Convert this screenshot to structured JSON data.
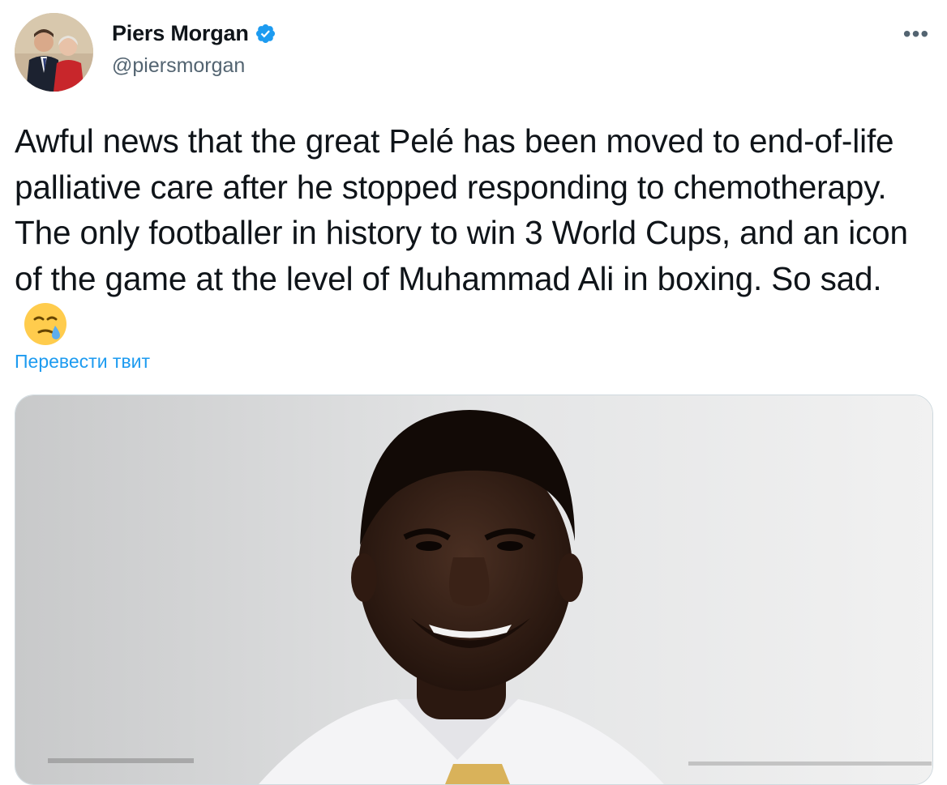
{
  "author": {
    "display_name": "Piers Morgan",
    "handle": "@piersmorgan",
    "verified_icon": "verified-badge-icon",
    "avatar_icon": "profile-photo"
  },
  "tweet": {
    "text": "Awful news that the great Pelé has been moved to end-of-life palliative care after he stopped responding to chemotherapy. The only footballer in history to win 3 World Cups, and an icon of the game at the level of Muhammad Ali in boxing. So sad.",
    "emoji": "face-holding-back-tears-icon",
    "translate_label": "Перевести твит"
  },
  "menu": {
    "more_icon": "more-options-icon",
    "more_glyph": "•••"
  },
  "media": {
    "type": "photo"
  },
  "colors": {
    "accent": "#1d9bf0",
    "text_primary": "#0f1419",
    "text_secondary": "#536471",
    "border": "#cfd9de"
  }
}
